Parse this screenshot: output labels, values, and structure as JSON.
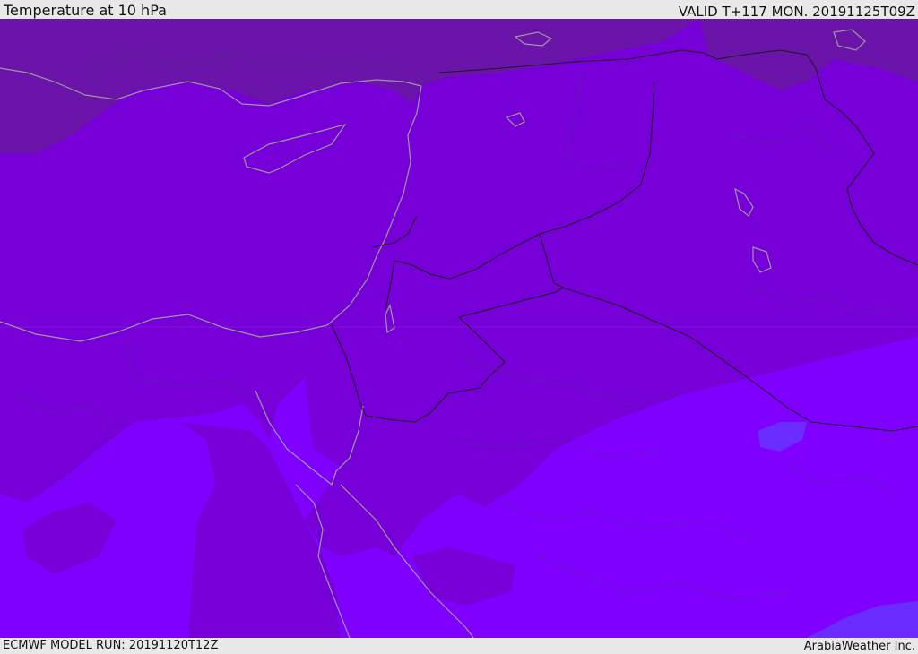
{
  "header": {
    "title": "Temperature at 10 hPa",
    "valid": "VALID T+117 MON. 20191125T09Z"
  },
  "footer": {
    "model_run": "ECMWF MODEL RUN: 20191120T12Z",
    "credit": "ArabiaWeather Inc."
  },
  "colors": {
    "band_coldest": "#6a14aa",
    "band_cold": "#7700d8",
    "band_mid": "#7f00ff",
    "band_warm": "#6a2cff",
    "coast": "#9a9a9a",
    "border": "#1a1a1a",
    "admin_border": "#4a3a70"
  }
}
